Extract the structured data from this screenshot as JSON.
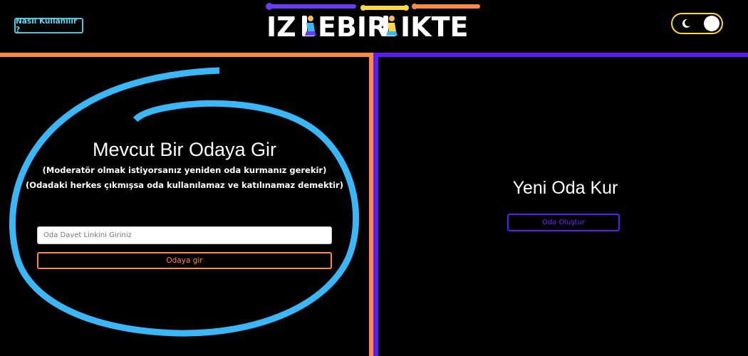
{
  "header": {
    "help_button": "Nasıl Kullanılır ?",
    "logo_text": "IZLEBIRLIKTE",
    "theme_toggle": {
      "state": "dark",
      "icon": "moon-icon"
    }
  },
  "colors": {
    "orange": "#ff8a48",
    "purple": "#5a1cf0",
    "cyan": "#4cc3e0",
    "swirl": "#3bb6f7",
    "toggle_border": "#ffd84a"
  },
  "join_room": {
    "title": "Mevcut Bir Odaya Gir",
    "note1": "(Moderatör olmak istiyorsanız yeniden oda kurmanız gerekir)",
    "note2": "(Odadaki herkes çıkmışsa oda kullanılamaz ve katılınamaz demektir)",
    "input_placeholder": "Oda Davet Linkini Giriniz",
    "input_value": "",
    "button": "Odaya gir"
  },
  "create_room": {
    "title": "Yeni Oda Kur",
    "button": "Oda Oluştur"
  }
}
